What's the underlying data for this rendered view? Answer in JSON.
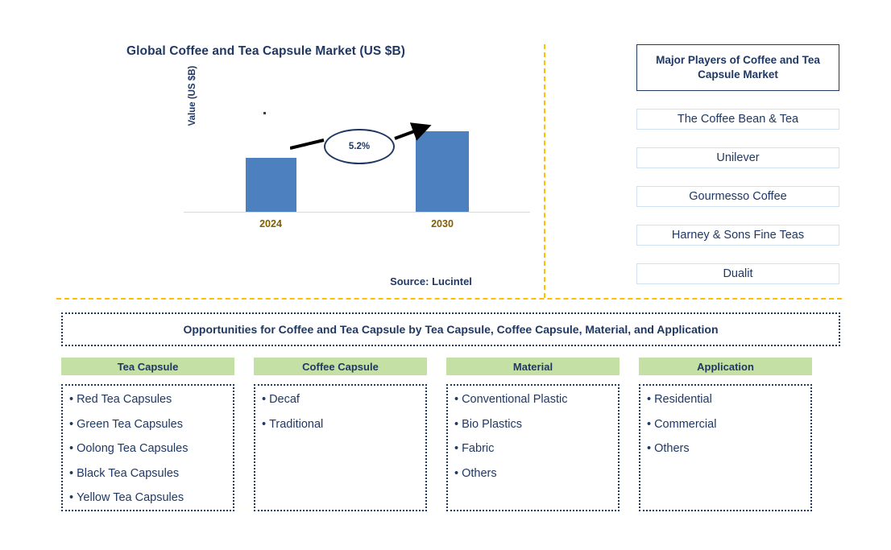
{
  "chart_panel": {
    "title": "Global Coffee and Tea Capsule Market (US $B)",
    "y_axis_label": "Value (US $B)",
    "source": "Source: Lucintel"
  },
  "chart_data": {
    "type": "bar",
    "title": "Global Coffee and Tea Capsule Market (US $B)",
    "categories": [
      "2024",
      "2030"
    ],
    "values": [
      67,
      100
    ],
    "xlabel": "",
    "ylabel": "Value (US $B)",
    "annotations": [
      {
        "label": "5.2%",
        "type": "cagr-bubble",
        "from": "2024",
        "to": "2030"
      }
    ],
    "grid": false,
    "legend": false
  },
  "players": {
    "header": "Major Players of Coffee and Tea Capsule Market",
    "items": [
      {
        "name": "The Coffee Bean & Tea"
      },
      {
        "name": "Unilever"
      },
      {
        "name": "Gourmesso Coffee"
      },
      {
        "name": "Harney & Sons Fine Teas"
      },
      {
        "name": "Dualit"
      }
    ]
  },
  "opportunities": {
    "banner": "Opportunities for Coffee and Tea Capsule by Tea Capsule, Coffee Capsule, Material, and Application",
    "segments": [
      {
        "header": "Tea Capsule",
        "items": [
          "Red Tea Capsules",
          "Green Tea Capsules",
          "Oolong Tea Capsules",
          "Black Tea Capsules",
          "Yellow Tea Capsules"
        ]
      },
      {
        "header": "Coffee Capsule",
        "items": [
          "Decaf",
          "Traditional"
        ]
      },
      {
        "header": "Material",
        "items": [
          "Conventional Plastic",
          "Bio Plastics",
          "Fabric",
          "Others"
        ]
      },
      {
        "header": "Application",
        "items": [
          "Residential",
          "Commercial",
          "Others"
        ]
      }
    ]
  },
  "colors": {
    "bar": "#4d80bf",
    "navy": "#1f3864",
    "divider": "#ffc000",
    "segment_header": "#c5e0a5",
    "player_border": "#cfe2f3",
    "axis_label": "#7f6000"
  },
  "bullet": "•"
}
